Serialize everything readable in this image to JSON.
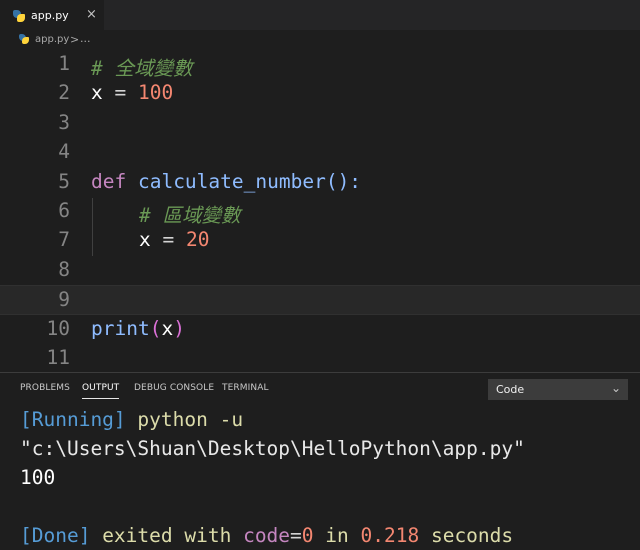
{
  "tab": {
    "filename": "app.py",
    "close": "×"
  },
  "breadcrumb": {
    "file": "app.py",
    "separator": ">",
    "more": "..."
  },
  "editor": {
    "lines": [
      {
        "num": "1",
        "comment": "# 全域變數"
      },
      {
        "num": "2",
        "var": "x",
        "op": " = ",
        "value": "100"
      },
      {
        "num": "3"
      },
      {
        "num": "4"
      },
      {
        "num": "5",
        "kw": "def",
        "fn": " calculate_number",
        "paren": "():"
      },
      {
        "num": "6",
        "comment": "# 區域變數"
      },
      {
        "num": "7",
        "var": "x",
        "op": " = ",
        "value": "20"
      },
      {
        "num": "8"
      },
      {
        "num": "9"
      },
      {
        "num": "10",
        "fn": "print",
        "open": "(",
        "arg": "x",
        "close": ")"
      },
      {
        "num": "11"
      }
    ]
  },
  "panel": {
    "tabs": [
      "PROBLEMS",
      "OUTPUT",
      "DEBUG CONSOLE",
      "TERMINAL"
    ],
    "active_tab": "OUTPUT",
    "channel": "Code",
    "output": {
      "running_tag": "[Running]",
      "command": " python -u",
      "path": "\"c:\\Users\\Shuan\\Desktop\\HelloPython\\app.py\"",
      "result": "100",
      "done_tag": "[Done]",
      "exited_with": " exited with ",
      "code_label": "code",
      "code_eq": "=",
      "code_val": "0",
      "in_word": " in ",
      "seconds_val": "0.218",
      "seconds_word": " seconds"
    }
  },
  "colors": {
    "background": "#1e1e1e",
    "keyword": "#c586c0",
    "number": "#f48771",
    "comment": "#6a9955"
  }
}
